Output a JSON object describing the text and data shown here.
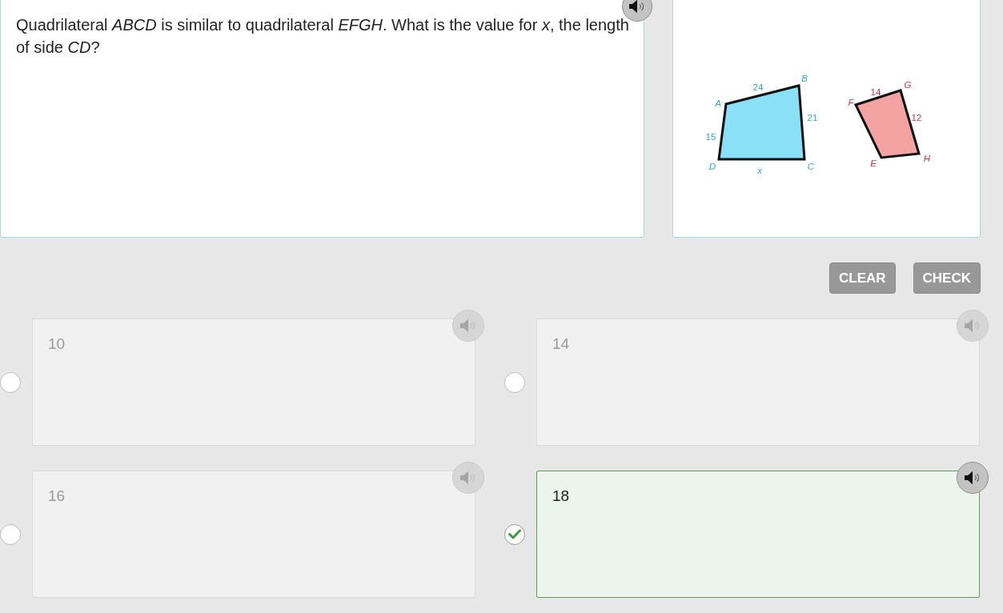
{
  "question": {
    "text": "Quadrilateral *ABCD* is similar to quadrilateral *EFGH*. What is the value for *x*, the length of side *CD*?"
  },
  "figure": {
    "shapes": [
      {
        "color": "#8ae0f6",
        "vertices": [
          "A",
          "B",
          "C",
          "D"
        ],
        "sides": [
          {
            "label": "24",
            "kind": "length"
          },
          {
            "label": "21",
            "kind": "length"
          },
          {
            "label": "x",
            "kind": "unknown"
          },
          {
            "label": "15",
            "kind": "length"
          }
        ]
      },
      {
        "color": "#f4a3a3",
        "vertices": [
          "F",
          "G",
          "H",
          "E"
        ],
        "sides": [
          {
            "label": "14",
            "kind": "length"
          },
          {
            "label": "12",
            "kind": "length"
          }
        ]
      }
    ]
  },
  "buttons": [
    {
      "label": "CLEAR",
      "disabled": true
    },
    {
      "label": "CHECK",
      "disabled": true
    }
  ],
  "options": [
    {
      "label": "10",
      "selected": false
    },
    {
      "label": "14",
      "selected": false
    },
    {
      "label": "16",
      "selected": false
    },
    {
      "label": "18",
      "selected": true
    }
  ]
}
